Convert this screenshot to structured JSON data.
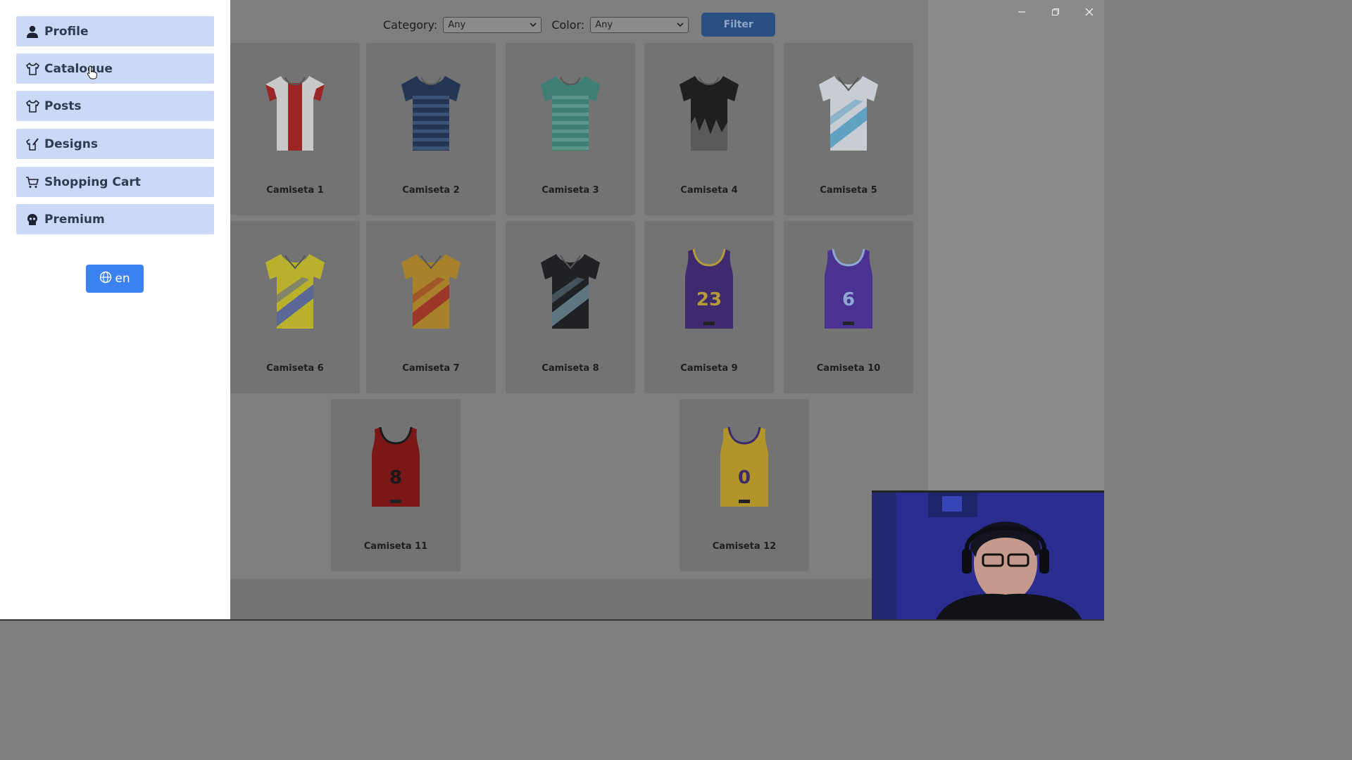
{
  "window": {
    "controls": [
      "minimize-icon",
      "restore-icon",
      "close-icon"
    ]
  },
  "sidebar": {
    "items": [
      {
        "label": "Profile",
        "icon": "user-icon"
      },
      {
        "label": "Catalogue",
        "icon": "shirt-icon"
      },
      {
        "label": "Posts",
        "icon": "shirt-icon"
      },
      {
        "label": "Designs",
        "icon": "shirt-brush-icon"
      },
      {
        "label": "Shopping Cart",
        "icon": "cart-icon"
      },
      {
        "label": "Premium",
        "icon": "crown-icon"
      }
    ],
    "language": {
      "label": "en",
      "icon": "globe-icon"
    }
  },
  "filters": {
    "category_label": "Category:",
    "category_value": "Any",
    "color_label": "Color:",
    "color_value": "Any",
    "filter_button": "Filter"
  },
  "products": [
    {
      "name": "Camiseta 1"
    },
    {
      "name": "Camiseta 2"
    },
    {
      "name": "Camiseta 3"
    },
    {
      "name": "Camiseta 4"
    },
    {
      "name": "Camiseta 5"
    },
    {
      "name": "Camiseta 6"
    },
    {
      "name": "Camiseta 7"
    },
    {
      "name": "Camiseta 8"
    },
    {
      "name": "Camiseta 9"
    },
    {
      "name": "Camiseta 10"
    },
    {
      "name": "Camiseta 11"
    },
    {
      "name": "Camiseta 12"
    }
  ],
  "colors": {
    "sidebar_item_bg": "#cbd9f7",
    "language_button": "#3b82f0",
    "overlay_dim": "#7f7f7f"
  }
}
